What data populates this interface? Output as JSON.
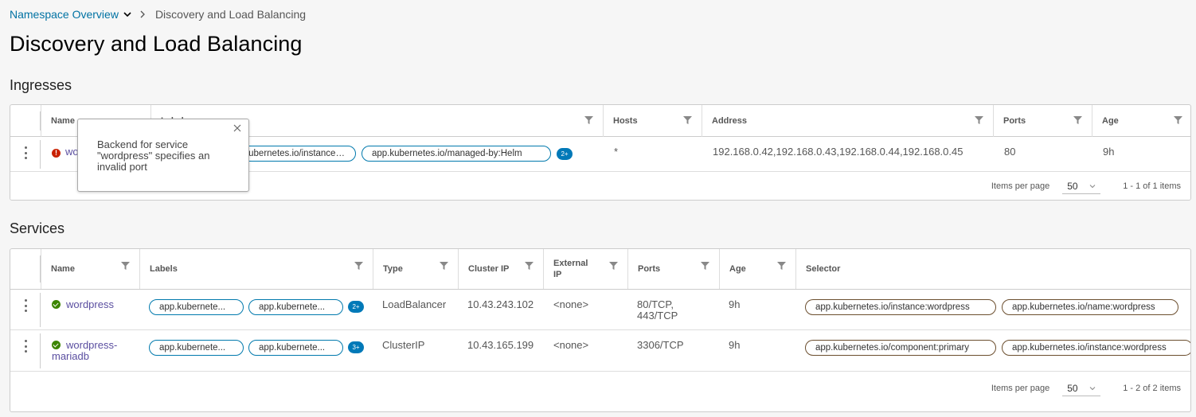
{
  "breadcrumb": {
    "parent": "Namespace Overview",
    "current": "Discovery and Load Balancing"
  },
  "page_title": "Discovery and Load Balancing",
  "ingresses": {
    "title": "Ingresses",
    "columns": [
      "Name",
      "Labels",
      "Hosts",
      "Address",
      "Ports",
      "Age"
    ],
    "rows": [
      {
        "name": "wordpress",
        "labels": [
          "app.kubernetes.io/instance:wordpress",
          "app.kubernetes.io/managed-by:Helm"
        ],
        "more": "2+",
        "hosts": "*",
        "address": "192.168.0.42,192.168.0.43,192.168.0.44,192.168.0.45",
        "ports": "80",
        "age": "9h"
      }
    ],
    "footer": {
      "items_per_page_label": "Items per page",
      "items_per_page": "50",
      "range": "1 - 1 of 1 items"
    }
  },
  "tooltip": {
    "text": "Backend for service \"wordpress\" specifies an invalid port"
  },
  "services": {
    "title": "Services",
    "columns": [
      "Name",
      "Labels",
      "Type",
      "Cluster IP",
      "External IP",
      "Ports",
      "Age",
      "Selector"
    ],
    "rows": [
      {
        "name": "wordpress",
        "labels": [
          "app.kubernetes.io/component:wordpress",
          "app.kubernetes.io/instance:wordpress"
        ],
        "labels_display": [
          "app.kubernete...",
          "app.kubernete..."
        ],
        "more": "2+",
        "type": "LoadBalancer",
        "cluster_ip": "10.43.243.102",
        "external_ip": "<none>",
        "ports": "80/TCP, 443/TCP",
        "age": "9h",
        "selector": [
          "app.kubernetes.io/instance:wordpress",
          "app.kubernetes.io/name:wordpress"
        ]
      },
      {
        "name": "wordpress-mariadb",
        "labels": [
          "app.kubernetes.io/component:primary",
          "app.kubernetes.io/instance:wordpress"
        ],
        "labels_display": [
          "app.kubernete...",
          "app.kubernete..."
        ],
        "more": "3+",
        "type": "ClusterIP",
        "cluster_ip": "10.43.165.199",
        "external_ip": "<none>",
        "ports": "3306/TCP",
        "age": "9h",
        "selector": [
          "app.kubernetes.io/component:primary",
          "app.kubernetes.io/instance:wordpress"
        ]
      }
    ],
    "footer": {
      "items_per_page_label": "Items per page",
      "items_per_page": "50",
      "range": "1 - 2 of 2 items"
    }
  },
  "colors": {
    "link": "#0072a3",
    "name_link": "#5a4ea0",
    "label_border": "#0079ad",
    "selector_border": "#6b4e2e",
    "badge": "#0079b8",
    "ok": "#3c8500",
    "error": "#c92100"
  }
}
